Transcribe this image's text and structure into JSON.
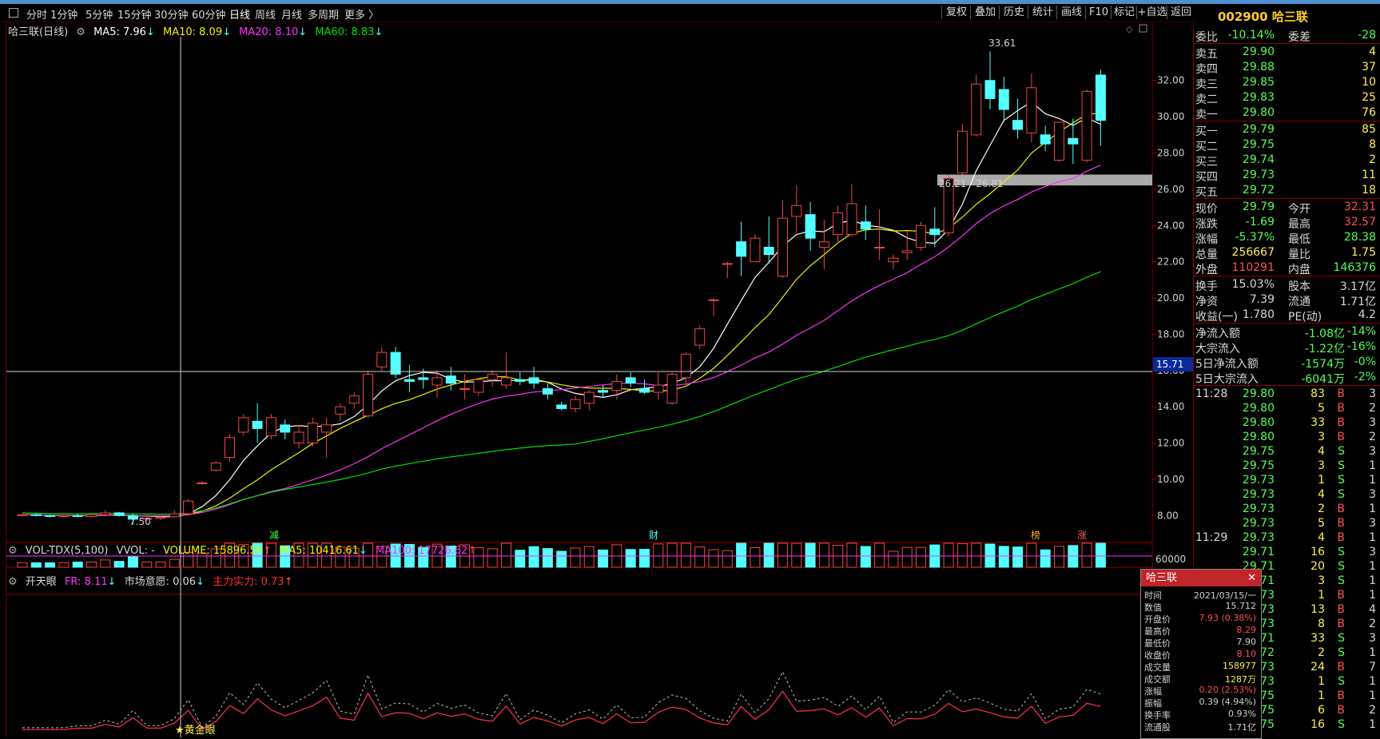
{
  "toolbar": {
    "tabs": [
      "分时",
      "1分钟",
      "5分钟",
      "15分钟",
      "30分钟",
      "60分钟",
      "日线",
      "周线",
      "月线",
      "多周期",
      "更多"
    ],
    "right_buttons": [
      "复权",
      "叠加",
      "历史",
      "统计",
      "画线",
      "F10",
      "标记",
      "+自选",
      "返回"
    ]
  },
  "stock": {
    "code": "002900",
    "name": "哈三联"
  },
  "chart": {
    "title": "哈三联(日线)",
    "ma5": "MA5: 7.96",
    "ma10": "MA10: 8.09",
    "ma20": "MA20: 8.10",
    "ma60": "MA60: 8.83",
    "high_label": "33.61",
    "low_label": "7.50",
    "zone_label": "26.21 - 26.81",
    "cursor_price": "15.71",
    "y_ticks": [
      "32.00",
      "30.00",
      "28.00",
      "26.00",
      "24.00",
      "22.00",
      "20.00",
      "18.00",
      "16.00",
      "14.00",
      "12.00",
      "10.00",
      "8.00"
    ],
    "markers": [
      "减",
      "财",
      "榜",
      "涨"
    ]
  },
  "volume": {
    "title": "VOL-TDX(5,100)",
    "vvol": "VVOL: -",
    "volume": "VOLUME: 15896.56",
    "ma5": "MA5: 10416.61",
    "ma100": "MA100: 17726.62",
    "y_tick": "60000"
  },
  "indicator": {
    "title": "开天眼",
    "fr": "FR: 8.11",
    "mkt": "市场意愿: 0.06",
    "main": "主力实力: 0.73",
    "signal": "★黄金眼"
  },
  "quote": {
    "wei_bi_label": "委比",
    "wei_bi": "-10.14%",
    "wei_cha_label": "委差",
    "wei_cha": "-28",
    "asks": [
      {
        "label": "卖五",
        "price": "29.90",
        "vol": "4"
      },
      {
        "label": "卖四",
        "price": "29.88",
        "vol": "37"
      },
      {
        "label": "卖三",
        "price": "29.85",
        "vol": "10"
      },
      {
        "label": "卖二",
        "price": "29.83",
        "vol": "25"
      },
      {
        "label": "卖一",
        "price": "29.80",
        "vol": "76"
      }
    ],
    "bids": [
      {
        "label": "买一",
        "price": "29.79",
        "vol": "85"
      },
      {
        "label": "买二",
        "price": "29.75",
        "vol": "8"
      },
      {
        "label": "买三",
        "price": "29.74",
        "vol": "2"
      },
      {
        "label": "买四",
        "price": "29.73",
        "vol": "11"
      },
      {
        "label": "买五",
        "price": "29.72",
        "vol": "18"
      }
    ],
    "stats": [
      {
        "k1": "现价",
        "v1": "29.79",
        "k2": "今开",
        "v2": "32.31"
      },
      {
        "k1": "涨跌",
        "v1": "-1.69",
        "k2": "最高",
        "v2": "32.57"
      },
      {
        "k1": "涨幅",
        "v1": "-5.37%",
        "k2": "最低",
        "v2": "28.38"
      },
      {
        "k1": "总量",
        "v1": "256667",
        "k2": "量比",
        "v2": "1.75"
      },
      {
        "k1": "外盘",
        "v1": "110291",
        "k2": "内盘",
        "v2": "146376"
      }
    ],
    "stats2": [
      {
        "k1": "换手",
        "v1": "15.03%",
        "k2": "股本",
        "v2": "3.17亿"
      },
      {
        "k1": "净资",
        "v1": "7.39",
        "k2": "流通",
        "v2": "1.71亿"
      },
      {
        "k1": "收益(一)",
        "v1": "1.780",
        "k2": "PE(动)",
        "v2": "4.2"
      }
    ],
    "flows": [
      {
        "k": "净流入额",
        "v": "-1.08亿",
        "p": "-14%"
      },
      {
        "k": "大宗流入",
        "v": "-1.22亿",
        "p": "-16%"
      },
      {
        "k": "5日净流入额",
        "v": "-1574万",
        "p": "-0%"
      },
      {
        "k": "5日大宗流入",
        "v": "-6041万",
        "p": "-2%"
      }
    ],
    "ticks": [
      {
        "t": "11:28",
        "p": "29.80",
        "v": "83",
        "d": "B",
        "n": "3"
      },
      {
        "t": "",
        "p": "29.80",
        "v": "5",
        "d": "B",
        "n": "2"
      },
      {
        "t": "",
        "p": "29.80",
        "v": "33",
        "d": "B",
        "n": "3"
      },
      {
        "t": "",
        "p": "29.80",
        "v": "3",
        "d": "B",
        "n": "2"
      },
      {
        "t": "",
        "p": "29.75",
        "v": "4",
        "d": "S",
        "n": "3"
      },
      {
        "t": "",
        "p": "29.75",
        "v": "3",
        "d": "S",
        "n": "1"
      },
      {
        "t": "",
        "p": "29.73",
        "v": "1",
        "d": "S",
        "n": "1"
      },
      {
        "t": "",
        "p": "29.73",
        "v": "4",
        "d": "S",
        "n": "3"
      },
      {
        "t": "",
        "p": "29.73",
        "v": "2",
        "d": "B",
        "n": "1"
      },
      {
        "t": "",
        "p": "29.73",
        "v": "5",
        "d": "B",
        "n": "3"
      },
      {
        "t": "11:29",
        "p": "29.73",
        "v": "4",
        "d": "B",
        "n": "1"
      },
      {
        "t": "",
        "p": "29.71",
        "v": "16",
        "d": "S",
        "n": "3"
      },
      {
        "t": "",
        "p": "29.71",
        "v": "20",
        "d": "S",
        "n": "1"
      },
      {
        "t": "",
        "p": "29.71",
        "v": "3",
        "d": "S",
        "n": "1"
      },
      {
        "t": "",
        "p": "29.73",
        "v": "1",
        "d": "B",
        "n": "1"
      },
      {
        "t": "",
        "p": "29.73",
        "v": "13",
        "d": "B",
        "n": "4"
      },
      {
        "t": "",
        "p": "29.73",
        "v": "8",
        "d": "B",
        "n": "2"
      },
      {
        "t": "",
        "p": "29.71",
        "v": "33",
        "d": "S",
        "n": "3"
      },
      {
        "t": "",
        "p": "29.72",
        "v": "2",
        "d": "S",
        "n": "1"
      },
      {
        "t": "",
        "p": "29.73",
        "v": "24",
        "d": "B",
        "n": "7"
      },
      {
        "t": "",
        "p": "29.73",
        "v": "1",
        "d": "S",
        "n": "1"
      },
      {
        "t": "",
        "p": "29.75",
        "v": "1",
        "d": "B",
        "n": "1"
      },
      {
        "t": "",
        "p": "29.75",
        "v": "6",
        "d": "B",
        "n": "2"
      },
      {
        "t": "",
        "p": "29.75",
        "v": "16",
        "d": "S",
        "n": "1"
      }
    ]
  },
  "tooltip": {
    "title": "哈三联",
    "rows": [
      {
        "k": "时间",
        "v": "2021/03/15/一"
      },
      {
        "k": "数值",
        "v": "15.712"
      },
      {
        "k": "开盘价",
        "v": "7.93 (0.38%)"
      },
      {
        "k": "最高价",
        "v": "8.29"
      },
      {
        "k": "最低价",
        "v": "7.90"
      },
      {
        "k": "收盘价",
        "v": "8.10"
      },
      {
        "k": "成交量",
        "v": "158977"
      },
      {
        "k": "成交额",
        "v": "1287万"
      },
      {
        "k": "涨幅",
        "v": "0.20 (2.53%)"
      },
      {
        "k": "振幅",
        "v": "0.39 (4.94%)"
      },
      {
        "k": "换手率",
        "v": "0.93%"
      },
      {
        "k": "流通股",
        "v": "1.71亿"
      }
    ]
  },
  "chart_data": {
    "type": "candlestick",
    "y_range": [
      7.0,
      34.5
    ],
    "candles": [
      [
        8.0,
        8.1,
        7.95,
        8.05
      ],
      [
        8.05,
        8.1,
        7.95,
        8.0
      ],
      [
        8.0,
        8.05,
        7.9,
        7.95
      ],
      [
        7.95,
        8.05,
        7.9,
        8.0
      ],
      [
        8.0,
        8.1,
        7.9,
        7.95
      ],
      [
        7.95,
        8.1,
        7.9,
        8.05
      ],
      [
        8.05,
        8.3,
        7.95,
        8.15
      ],
      [
        8.15,
        8.2,
        7.95,
        8.0
      ],
      [
        8.0,
        8.1,
        7.5,
        7.8
      ],
      [
        7.8,
        7.9,
        7.7,
        7.85
      ],
      [
        7.85,
        7.95,
        7.75,
        7.9
      ],
      [
        7.93,
        8.29,
        7.9,
        8.1
      ],
      [
        8.1,
        8.9,
        8.0,
        8.8
      ],
      [
        9.8,
        9.9,
        9.7,
        9.8
      ],
      [
        10.5,
        11.0,
        10.4,
        10.9
      ],
      [
        11.2,
        12.5,
        11.0,
        12.3
      ],
      [
        12.6,
        13.6,
        12.4,
        13.4
      ],
      [
        13.2,
        14.2,
        12.0,
        12.8
      ],
      [
        12.4,
        13.6,
        12.2,
        13.4
      ],
      [
        13.0,
        13.3,
        12.2,
        12.6
      ],
      [
        12.0,
        13.0,
        11.7,
        12.6
      ],
      [
        12.0,
        13.4,
        11.8,
        13.1
      ],
      [
        12.6,
        13.4,
        11.2,
        13.0
      ],
      [
        13.6,
        14.2,
        13.2,
        14.0
      ],
      [
        14.2,
        14.8,
        13.9,
        14.6
      ],
      [
        13.5,
        16.0,
        13.4,
        15.8
      ],
      [
        16.2,
        17.3,
        16.0,
        17.0
      ],
      [
        17.0,
        17.3,
        15.6,
        15.8
      ],
      [
        15.5,
        16.3,
        14.8,
        15.4
      ],
      [
        15.6,
        16.1,
        15.0,
        15.5
      ],
      [
        15.2,
        16.0,
        14.5,
        15.6
      ],
      [
        15.7,
        16.2,
        14.9,
        15.3
      ],
      [
        15.0,
        15.8,
        14.4,
        15.0
      ],
      [
        14.8,
        15.6,
        14.6,
        15.5
      ],
      [
        15.5,
        16.0,
        15.1,
        15.8
      ],
      [
        15.2,
        17.0,
        15.0,
        15.6
      ],
      [
        15.5,
        15.9,
        15.2,
        15.4
      ],
      [
        15.6,
        16.2,
        15.0,
        15.3
      ],
      [
        15.0,
        15.3,
        14.4,
        14.7
      ],
      [
        14.1,
        14.3,
        13.8,
        13.9
      ],
      [
        13.9,
        14.6,
        13.7,
        14.4
      ],
      [
        14.2,
        14.9,
        13.8,
        14.8
      ],
      [
        14.9,
        15.2,
        14.5,
        14.8
      ],
      [
        14.9,
        15.8,
        14.4,
        15.4
      ],
      [
        15.6,
        15.9,
        15.1,
        15.3
      ],
      [
        15.0,
        15.5,
        14.7,
        14.8
      ],
      [
        14.8,
        15.9,
        14.4,
        15.2
      ],
      [
        14.2,
        15.9,
        14.1,
        15.8
      ],
      [
        15.6,
        17.0,
        15.2,
        16.9
      ],
      [
        17.4,
        18.5,
        17.2,
        18.3
      ],
      [
        19.9,
        20.0,
        19.0,
        19.9
      ],
      [
        21.9,
        22.0,
        21.1,
        21.9
      ],
      [
        23.1,
        24.2,
        21.2,
        22.3
      ],
      [
        22.0,
        23.5,
        22.0,
        23.3
      ],
      [
        22.8,
        24.5,
        21.9,
        22.4
      ],
      [
        21.2,
        25.4,
        21.1,
        24.4
      ],
      [
        24.5,
        26.2,
        23.6,
        25.1
      ],
      [
        24.6,
        25.3,
        22.6,
        23.3
      ],
      [
        22.8,
        24.3,
        21.6,
        23.1
      ],
      [
        23.5,
        25.1,
        23.0,
        24.7
      ],
      [
        23.5,
        26.3,
        23.4,
        25.2
      ],
      [
        24.2,
        25.1,
        23.2,
        23.8
      ],
      [
        22.8,
        24.9,
        22.1,
        22.8
      ],
      [
        22.0,
        22.4,
        21.6,
        22.2
      ],
      [
        22.5,
        23.7,
        22.1,
        22.6
      ],
      [
        22.8,
        24.2,
        22.6,
        24.0
      ],
      [
        23.8,
        25.0,
        22.8,
        23.5
      ],
      [
        23.6,
        26.8,
        23.4,
        26.6
      ],
      [
        26.9,
        29.6,
        26.8,
        29.2
      ],
      [
        29.0,
        32.3,
        28.9,
        31.8
      ],
      [
        32.0,
        33.6,
        30.4,
        31.0
      ],
      [
        31.5,
        32.2,
        29.7,
        30.4
      ],
      [
        29.8,
        31.0,
        28.8,
        29.3
      ],
      [
        29.1,
        32.4,
        28.6,
        31.6
      ],
      [
        29.0,
        29.5,
        28.1,
        28.5
      ],
      [
        27.6,
        29.7,
        27.5,
        29.7
      ],
      [
        28.8,
        29.9,
        27.4,
        28.5
      ],
      [
        27.6,
        31.5,
        27.5,
        31.4
      ],
      [
        32.3,
        32.6,
        28.4,
        29.8
      ]
    ]
  },
  "colors": {
    "up": "#f04545",
    "down": "#54ffff",
    "ma5": "#ffffff",
    "ma10": "#f0f000",
    "ma20": "#ff30ff",
    "ma60": "#00e000"
  }
}
